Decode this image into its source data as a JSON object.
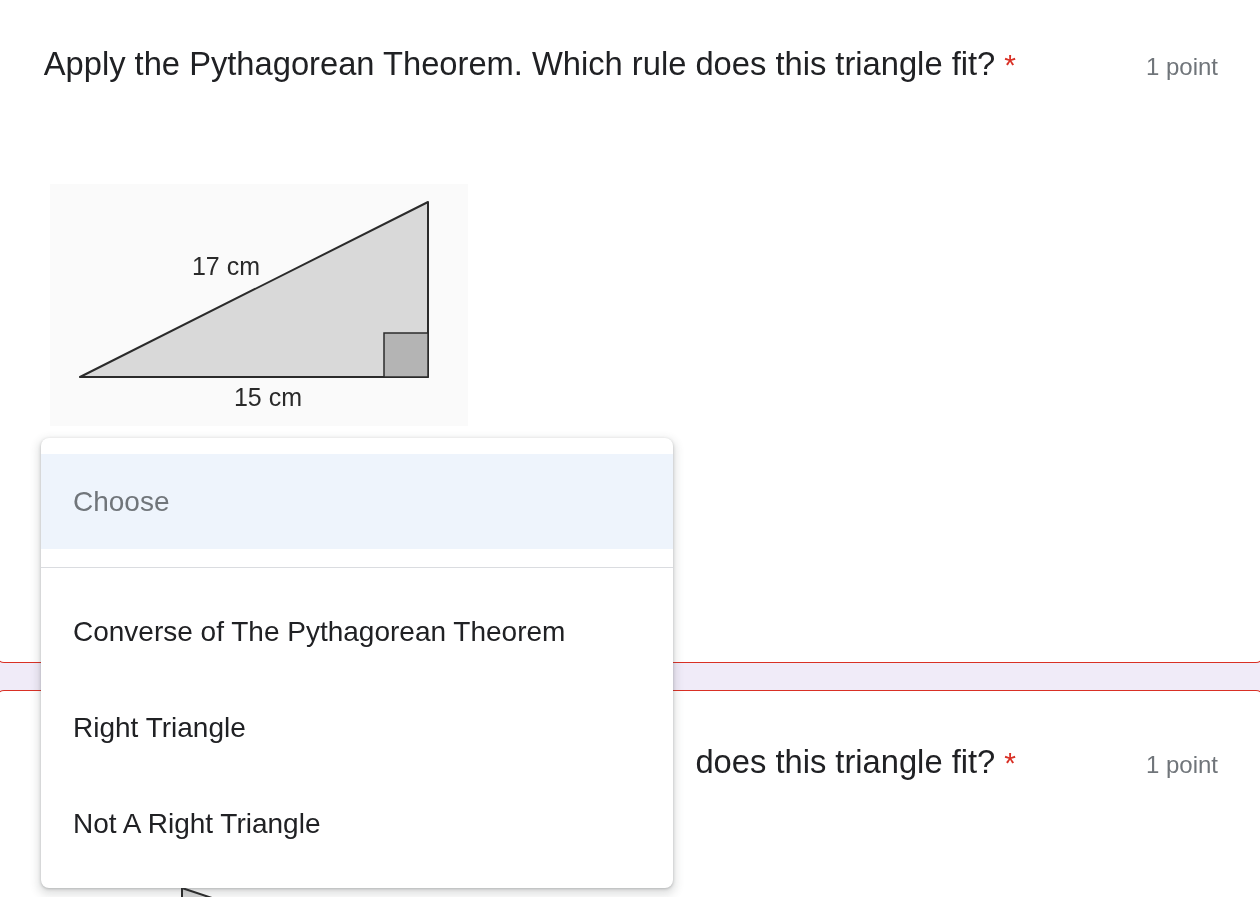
{
  "questions": [
    {
      "title": "Apply the Pythagorean Theorem. Which rule does this triangle fit?",
      "required_mark": "*",
      "points": "1 point",
      "error": true,
      "figure": {
        "kind": "right-triangle",
        "labels": [
          "17 cm",
          "15 cm"
        ]
      }
    },
    {
      "title": "does this triangle fit?",
      "required_mark": "*",
      "points": "1 point",
      "error": true,
      "figure": {
        "kind": "triangle-tip"
      }
    }
  ],
  "dropdown": {
    "options": [
      {
        "label": "Choose",
        "kind": "placeholder",
        "selected": true
      },
      {
        "label": "Converse of The Pythagorean Theorem",
        "kind": "option",
        "selected": false
      },
      {
        "label": "Right Triangle",
        "kind": "option",
        "selected": false
      },
      {
        "label": "Not A Right Triangle",
        "kind": "option",
        "selected": false
      }
    ]
  }
}
